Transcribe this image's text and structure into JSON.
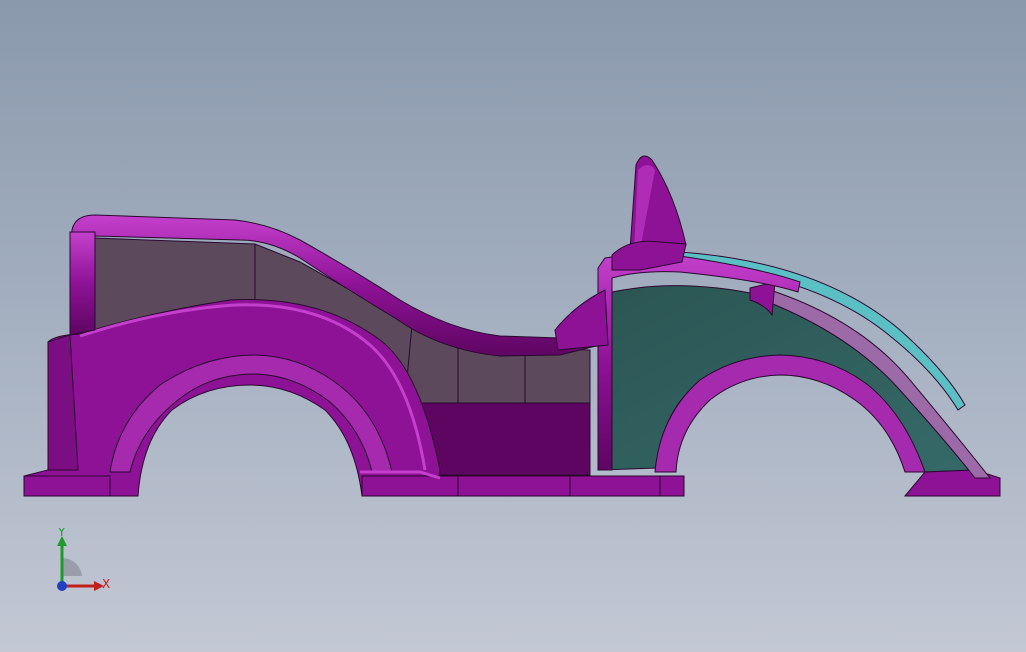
{
  "viewport": {
    "colors": {
      "body": "#8e1296",
      "body_dark": "#5e0562",
      "body_highlight": "#c23ec8",
      "interior_panel": "#5b4a5a",
      "interior_panel_light": "#6c5a6a",
      "dark_panel": "#2e5f5e",
      "accent_stripe": "#5bc0c4",
      "edge": "#2a0830"
    }
  },
  "triad": {
    "x_label": "X",
    "y_label": "Y",
    "colors": {
      "x": "#c0201e",
      "y": "#1f9a2c",
      "z": "#2040c0"
    }
  }
}
